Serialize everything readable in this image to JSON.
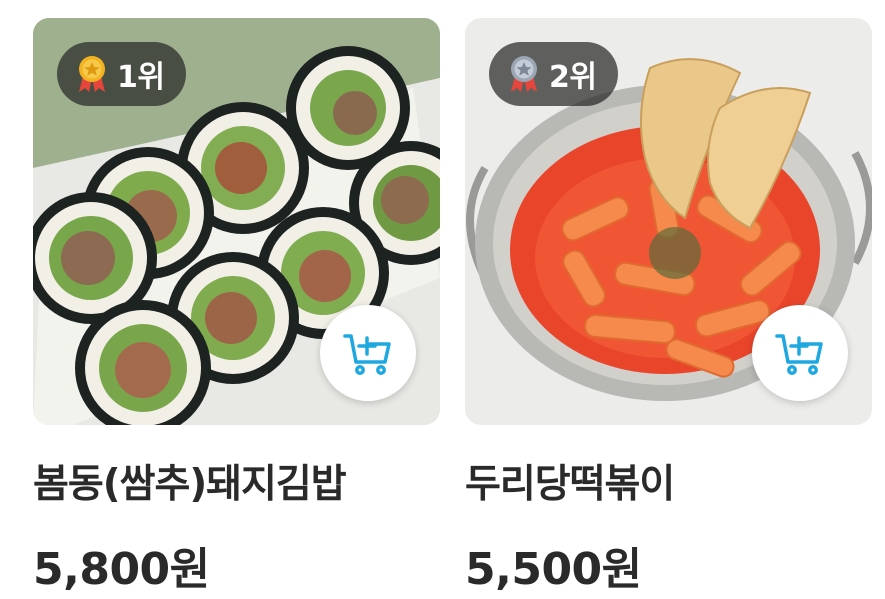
{
  "products": [
    {
      "rank_label": "1위",
      "rank_medal": "gold-medal-icon",
      "name": "봄동(쌈추)돼지김밥",
      "price": "5,800원",
      "image": "kimbap-photo"
    },
    {
      "rank_label": "2위",
      "rank_medal": "silver-medal-icon",
      "name": "두리당떡볶이",
      "price": "5,500원",
      "image": "tteokbokki-photo"
    }
  ],
  "colors": {
    "cart_icon": "#1fa8e0",
    "badge_bg": "#2a2a2a",
    "text": "#2a2a2a",
    "gold": "#f3b321",
    "silver": "#9aa6b4",
    "ribbon": "#e5463b"
  },
  "icons": {
    "cart": "add-to-cart-icon"
  }
}
